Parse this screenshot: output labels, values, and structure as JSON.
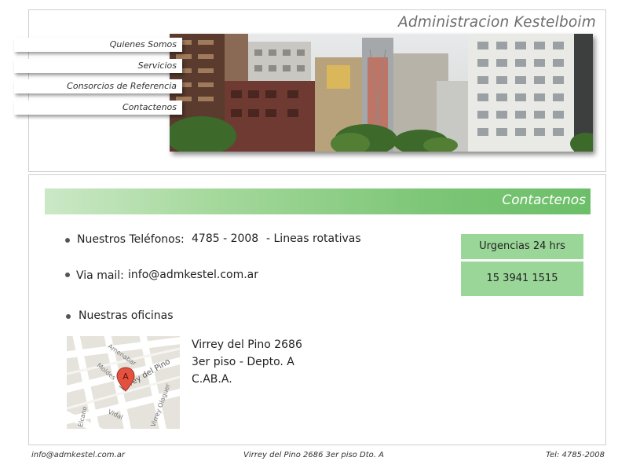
{
  "header": {
    "title": "Administracion Kestelboim"
  },
  "nav": {
    "items": [
      {
        "label": "Quienes Somos"
      },
      {
        "label": "Servicios"
      },
      {
        "label": "Consorcios de Referencia"
      },
      {
        "label": "Contactenos"
      }
    ]
  },
  "section": {
    "title": "Contactenos"
  },
  "contact": {
    "phones_label": "Nuestros Teléfonos:",
    "phones_number": "4785 - 2008",
    "phones_note": "- Lineas rotativas",
    "mail_label": "Via mail:",
    "mail_value": "info@admkestel.com.ar",
    "offices_label": "Nuestras oficinas"
  },
  "urgencias": {
    "label": "Urgencias 24 hrs",
    "number": "15 3941 1515"
  },
  "address": {
    "line1": "Virrey del Pino 2686",
    "line2": "3er piso - Depto. A",
    "line3": "C.AB.A."
  },
  "map": {
    "marker_letter": "A",
    "streets": [
      "Amenabar",
      "Virrey del Pino",
      "Moldes",
      "Elcano",
      "Vidal",
      "Virrey Olaguer"
    ]
  },
  "footer": {
    "email": "info@admkestel.com.ar",
    "address": "Virrey del Pino 2686 3er piso Dto. A",
    "phone": "Tel: 4785-2008"
  },
  "colors": {
    "accent_green": "#7dc677",
    "urgencias_bg": "#9bd699"
  }
}
